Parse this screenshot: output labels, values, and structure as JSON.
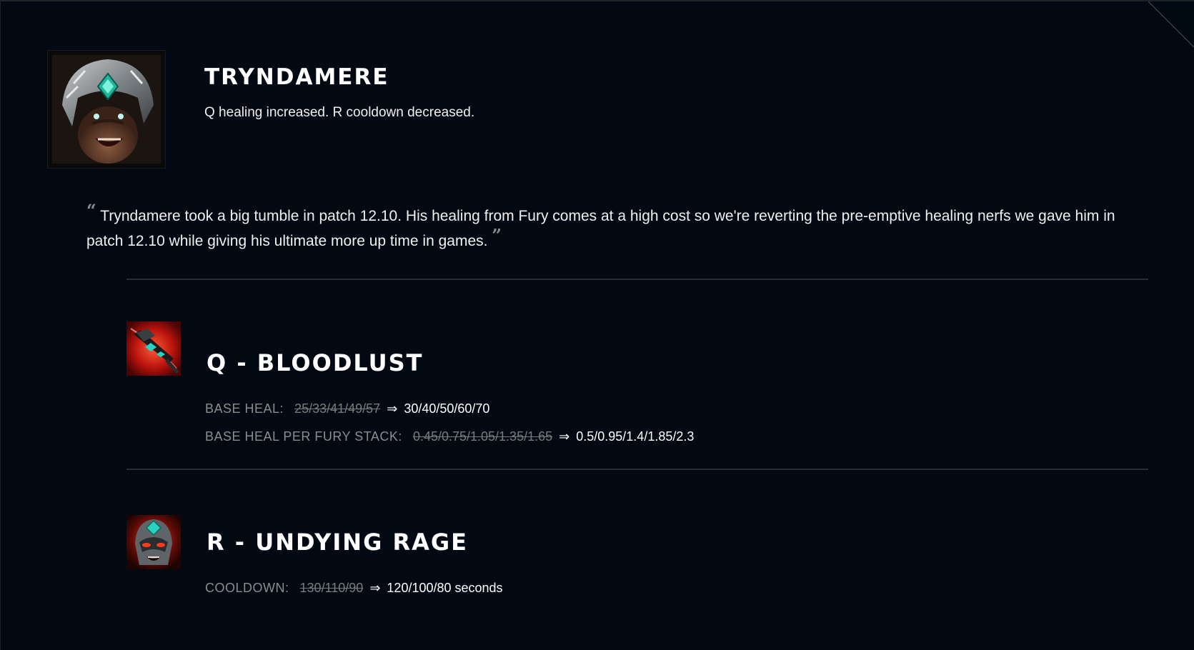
{
  "champion": {
    "name": "TRYNDAMERE",
    "summary": "Q healing increased. R cooldown decreased.",
    "portrait_icon": "tryndamere-portrait-icon"
  },
  "quote": {
    "open_mark": "“",
    "text": "Tryndamere took a big tumble in patch 12.10. His healing from Fury comes at a high cost so we're reverting the pre-emptive healing nerfs we gave him in patch 12.10 while giving his ultimate more up time in games.",
    "close_mark": "”"
  },
  "abilities": [
    {
      "title": "Q - BLOODLUST",
      "icon": "bloodlust-ability-icon",
      "changes": [
        {
          "attribute": "BASE HEAL:",
          "old": "25/33/41/49/57",
          "arrow": "⇒",
          "new": "30/40/50/60/70"
        },
        {
          "attribute": "BASE HEAL PER FURY STACK:",
          "old": "0.45/0.75/1.05/1.35/1.65",
          "arrow": "⇒",
          "new": "0.5/0.95/1.4/1.85/2.3"
        }
      ]
    },
    {
      "title": "R - UNDYING RAGE",
      "icon": "undying-rage-ability-icon",
      "changes": [
        {
          "attribute": "COOLDOWN:",
          "old": "130/110/90",
          "arrow": "⇒",
          "new": "120/100/80 seconds"
        }
      ]
    }
  ],
  "colors": {
    "background": "#010a13",
    "text_primary": "#ffffff",
    "text_muted": "#8c8c8c",
    "divider": "#282e36"
  }
}
